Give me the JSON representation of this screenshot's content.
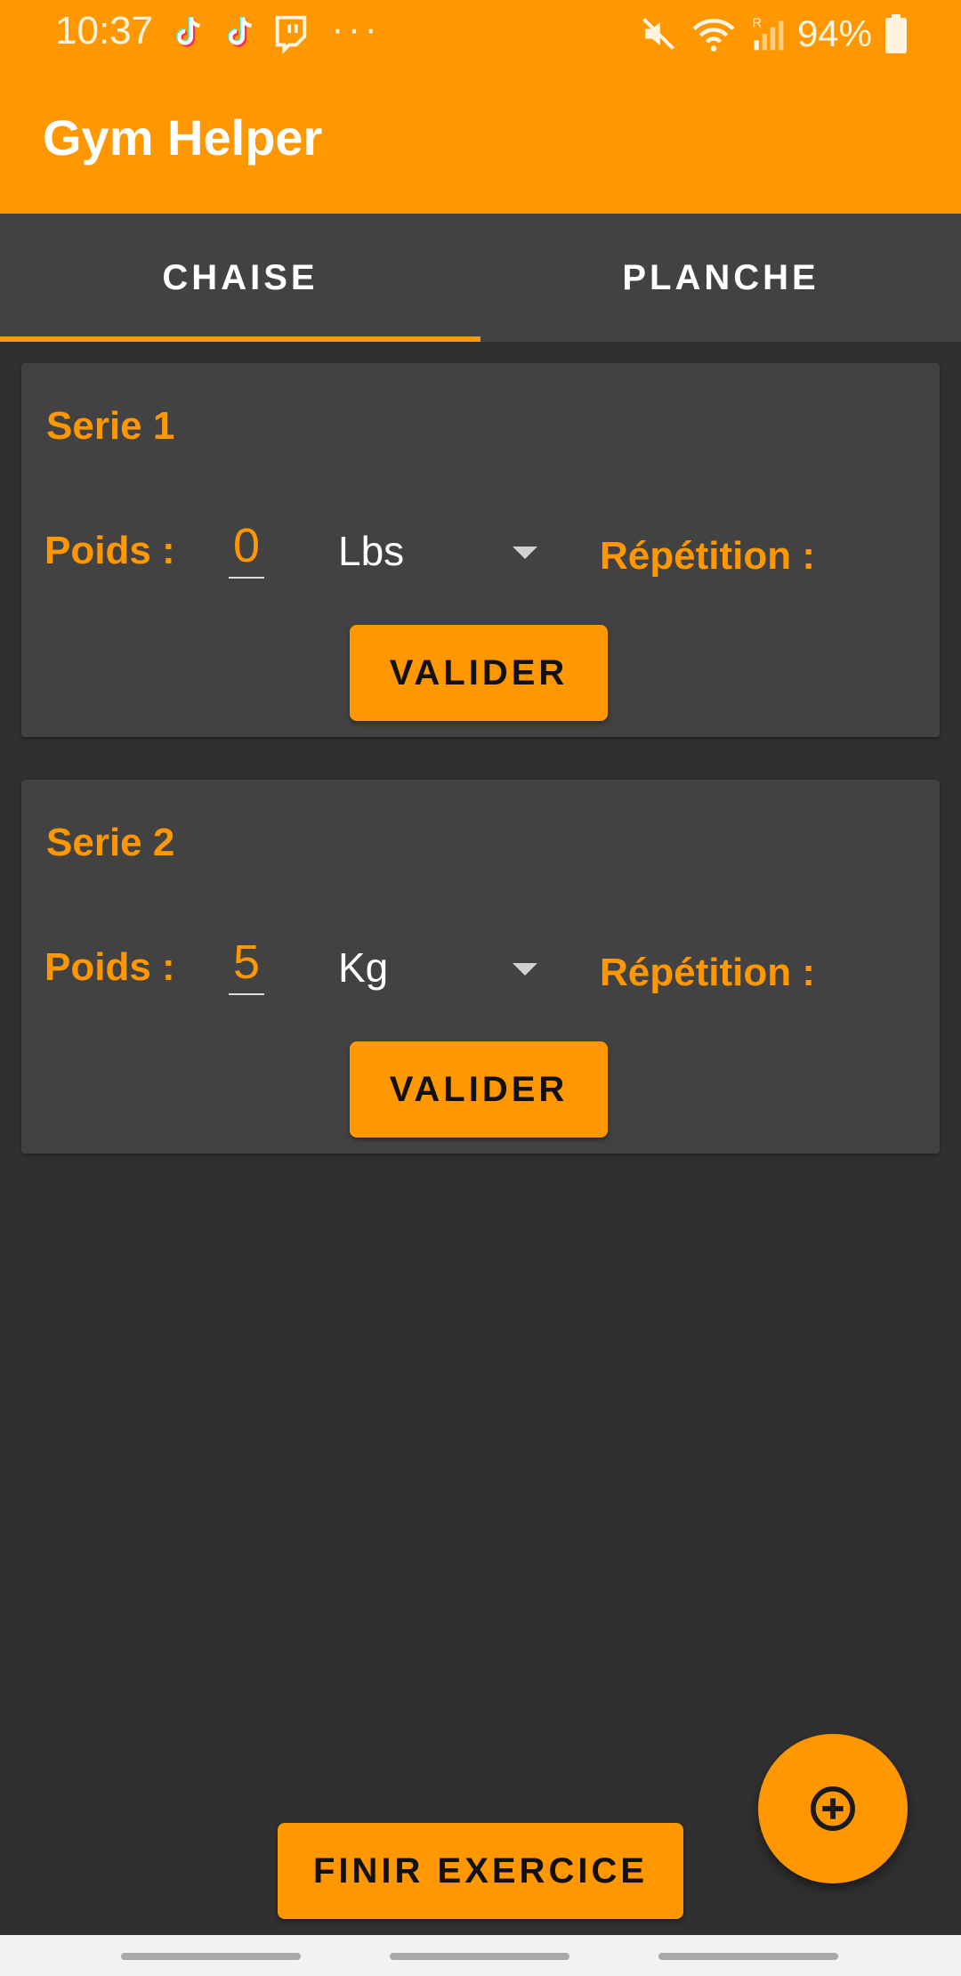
{
  "status_bar": {
    "time": "10:37",
    "overflow": "···",
    "battery": "94%",
    "icons": [
      "tiktok-icon",
      "tiktok-icon",
      "twitch-icon",
      "mute-icon",
      "wifi-icon",
      "signal-icon",
      "battery-icon"
    ]
  },
  "app": {
    "title": "Gym Helper",
    "accent_color": "#ff9800",
    "background_color": "#303030",
    "card_color": "#424242"
  },
  "tabs": [
    {
      "label": "CHAISE",
      "active": true
    },
    {
      "label": "PLANCHE",
      "active": false
    }
  ],
  "series": [
    {
      "title": "Serie 1",
      "weight_label": "Poids :",
      "weight_value": "0",
      "unit": "Lbs",
      "rep_label": "Répétition :",
      "button": "VALIDER"
    },
    {
      "title": "Serie 2",
      "weight_label": "Poids :",
      "weight_value": "5",
      "unit": "Kg",
      "rep_label": "Répétition :",
      "button": "VALIDER"
    }
  ],
  "actions": {
    "finish_label": "FINIR EXERCICE",
    "add_icon": "add-circle-icon"
  }
}
